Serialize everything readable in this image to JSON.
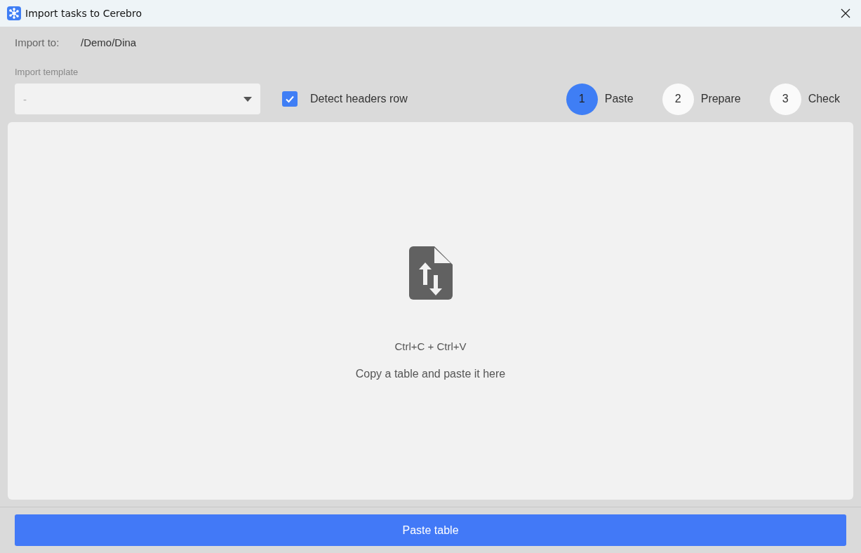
{
  "window": {
    "title": "Import tasks to Cerebro"
  },
  "import_to": {
    "label": "Import to:",
    "value": "/Demo/Dina"
  },
  "template": {
    "label": "Import template",
    "value": "-"
  },
  "detect_headers": {
    "label": "Detect headers row",
    "checked": true
  },
  "steps": [
    {
      "number": "1",
      "label": "Paste",
      "selected": true
    },
    {
      "number": "2",
      "label": "Prepare",
      "selected": false
    },
    {
      "number": "3",
      "label": "Check",
      "selected": false
    }
  ],
  "drop_area": {
    "shortcut": "Ctrl+C + Ctrl+V",
    "hint": "Copy a table and paste it here"
  },
  "button": "Paste table"
}
